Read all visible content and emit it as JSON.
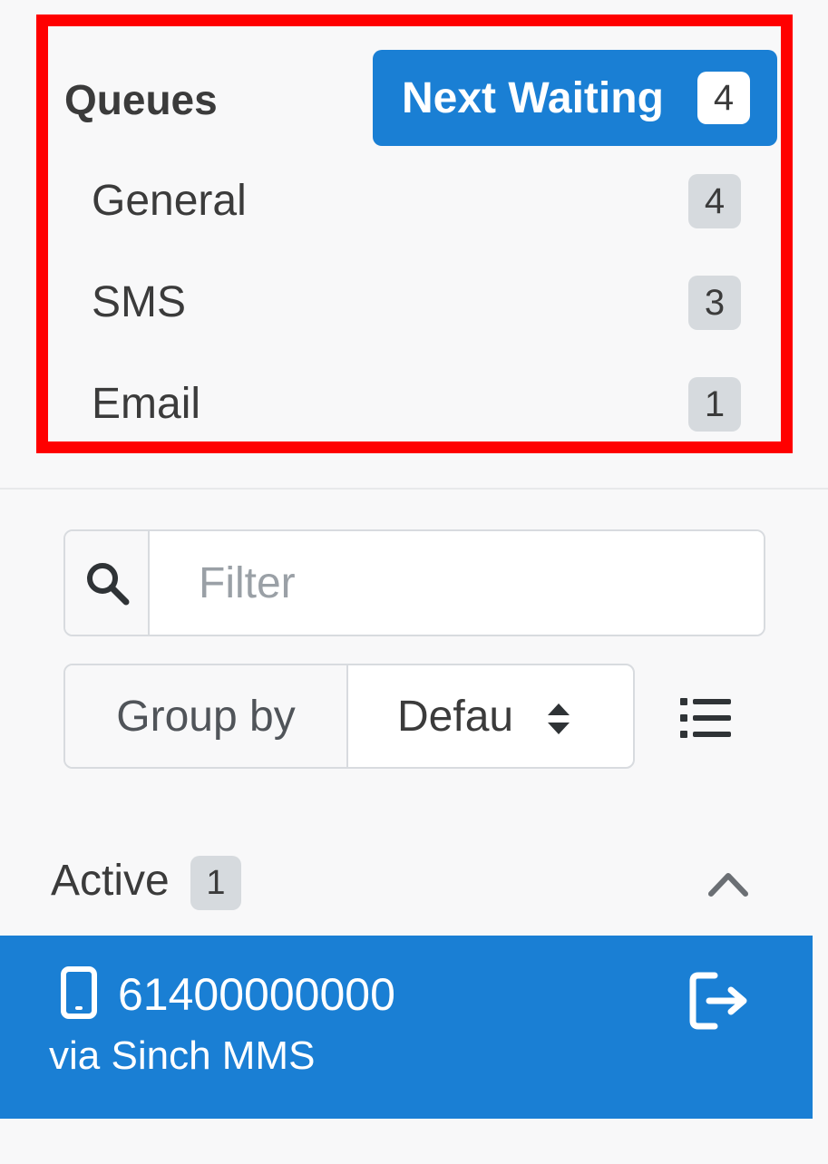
{
  "queues": {
    "title": "Queues",
    "next_waiting": {
      "label": "Next Waiting",
      "count": "4"
    },
    "items": [
      {
        "label": "General",
        "count": "4"
      },
      {
        "label": "SMS",
        "count": "3"
      },
      {
        "label": "Email",
        "count": "1"
      }
    ]
  },
  "filter": {
    "placeholder": "Filter",
    "icon": "search-icon"
  },
  "group_by": {
    "label": "Group by",
    "selected": "Defau",
    "icon": "list-icon"
  },
  "active": {
    "title": "Active",
    "count": "1",
    "items": [
      {
        "number": "61400000000",
        "via": "via Sinch MMS",
        "channel_icon": "mobile-phone-icon",
        "action_icon": "sign-out-icon"
      }
    ]
  },
  "colors": {
    "accent": "#1a7fd4",
    "highlight_border": "#ff0000",
    "badge": "#d6dade",
    "background": "#f8f8f9"
  }
}
